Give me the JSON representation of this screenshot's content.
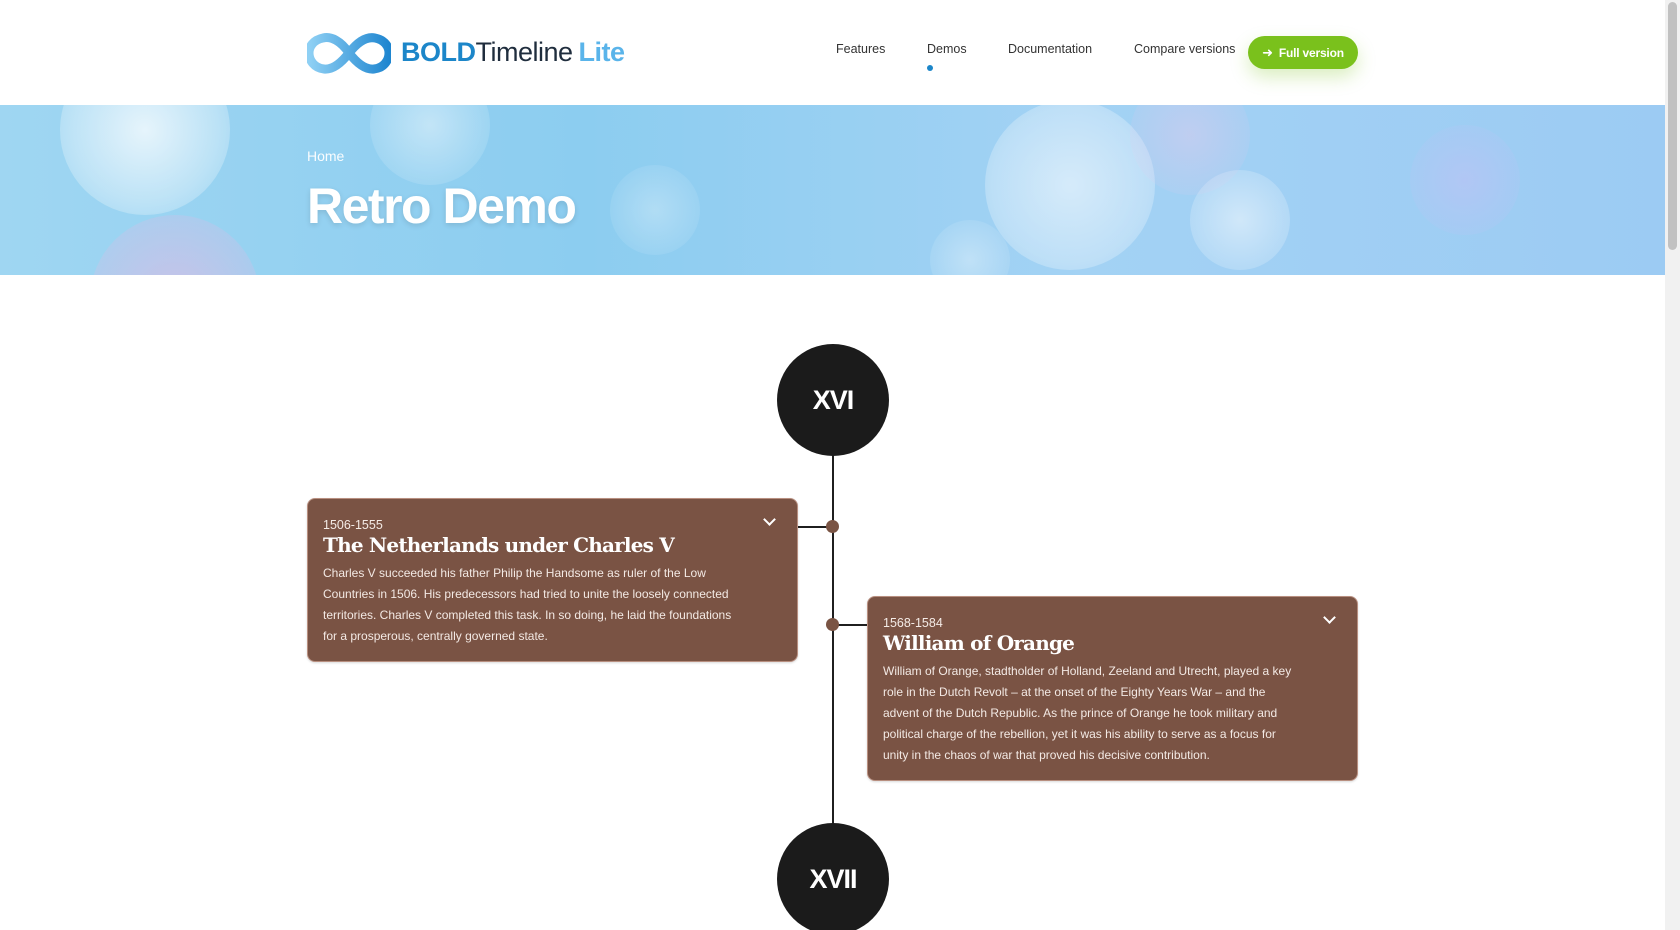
{
  "logo": {
    "bold": "BOLD",
    "mid": "Timeline",
    "lite": "Lite"
  },
  "nav": {
    "items": [
      {
        "label": "Features",
        "active": false
      },
      {
        "label": "Demos",
        "active": true
      },
      {
        "label": "Documentation",
        "active": false
      },
      {
        "label": "Compare versions",
        "active": false
      }
    ],
    "cta_label": "Full version"
  },
  "hero": {
    "breadcrumb": "Home",
    "title": "Retro Demo"
  },
  "timeline": {
    "eras": [
      "XVI",
      "XVII"
    ],
    "items": [
      {
        "date": "1506-1555",
        "title": "The Netherlands under Charles V",
        "lines": [
          "Charles V succeeded his father Philip the Handsome as ruler of the Low",
          "Countries in 1506. His predecessors had tried to unite the loosely connected",
          "territories. Charles V completed this task. In so doing, he laid the foundations",
          "for a prosperous, centrally governed state."
        ]
      },
      {
        "date": "1568-1584",
        "title": "William of Orange",
        "lines": [
          "William of Orange, stadtholder of Holland, Zeeland and Utrecht, played a key",
          "role in the Dutch Revolt – at the onset of the Eighty Years War – and the",
          "advent of the Dutch Republic. As the prince of Orange he took military and",
          "political charge of the rebellion, yet it was his ability to serve as a focus for",
          "unity in the chaos of war that proved his decisive contribution."
        ]
      }
    ]
  },
  "colors": {
    "accent": "#1c86c9",
    "cta": "#7ac11c",
    "card": "#7a5344",
    "era": "#1b1b1b"
  }
}
